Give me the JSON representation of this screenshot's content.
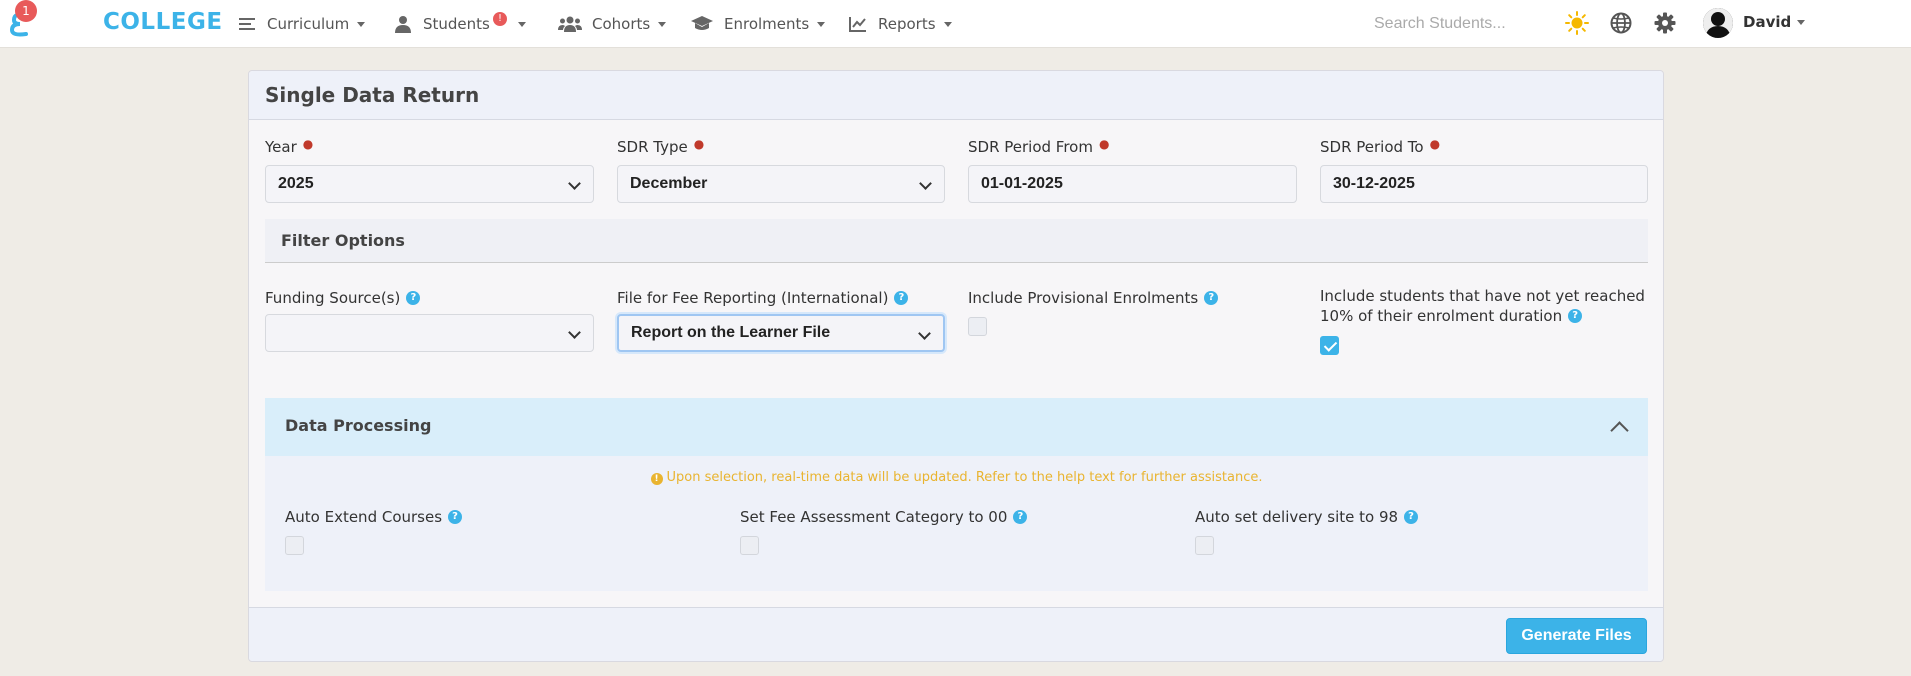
{
  "nav": {
    "logo_badge": "1",
    "brand": "COLLEGE",
    "items": [
      {
        "label": "Curriculum",
        "icon": "menu-icon"
      },
      {
        "label": "Students",
        "icon": "user-icon",
        "alert": "!"
      },
      {
        "label": "Cohorts",
        "icon": "users-icon"
      },
      {
        "label": "Enrolments",
        "icon": "graduation-cap-icon"
      },
      {
        "label": "Reports",
        "icon": "line-chart-icon"
      }
    ],
    "search_placeholder": "Search Students...",
    "user": "David"
  },
  "card": {
    "title": "Single Data Return",
    "fields": {
      "year": {
        "label": "Year",
        "value": "2025"
      },
      "sdr_type": {
        "label": "SDR Type",
        "value": "December"
      },
      "period_from": {
        "label": "SDR Period From",
        "value": "01-01-2025"
      },
      "period_to": {
        "label": "SDR Period To",
        "value": "30-12-2025"
      }
    },
    "filter": {
      "title": "Filter Options",
      "funding_source": {
        "label": "Funding Source(s)",
        "value": ""
      },
      "fee_file": {
        "label": "File for Fee Reporting (International)",
        "value": "Report on the Learner File"
      },
      "provisional": {
        "label": "Include Provisional Enrolments",
        "checked": false
      },
      "ten_percent": {
        "label_line1": "Include students that have not yet reached",
        "label_line2": "10% of their enrolment duration",
        "checked": true
      }
    },
    "data_processing": {
      "title": "Data Processing",
      "note": "Upon selection, real-time data will be updated. Refer to the help text for further assistance.",
      "options": [
        {
          "label": "Auto Extend Courses",
          "checked": false
        },
        {
          "label": "Set Fee Assessment Category to 00",
          "checked": false
        },
        {
          "label": "Auto set delivery site to 98",
          "checked": false
        }
      ]
    },
    "generate_label": "Generate Files"
  },
  "colors": {
    "accent": "#3cb3e8",
    "alert": "#e85a5a",
    "warning": "#e9b430"
  }
}
